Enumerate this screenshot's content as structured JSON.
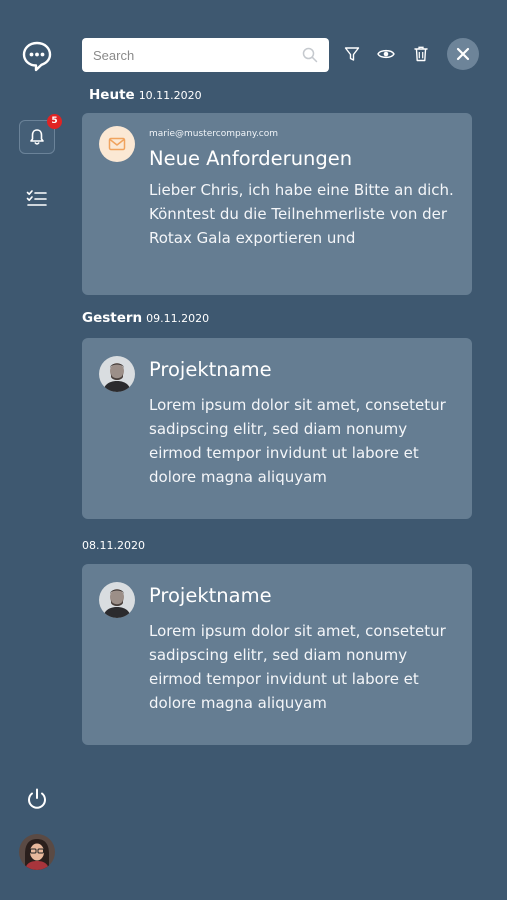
{
  "sidebar": {
    "chat_icon": "chat-bubble-icon",
    "notifications_icon": "bell-icon",
    "notifications_count": "5",
    "tasks_icon": "checklist-icon",
    "power_icon": "power-icon"
  },
  "toolbar": {
    "search_placeholder": "Search",
    "icons": [
      "search-icon",
      "filter-icon",
      "eye-icon",
      "trash-icon",
      "close-icon"
    ]
  },
  "groups": [
    {
      "day": "Heute",
      "date": "10.11.2020",
      "notification": {
        "sender": "marie@mustercompany.com",
        "title": "Neue Anforderungen",
        "body": "Lieber Chris, ich habe eine Bitte an dich. Könntest du die Teilnehmerliste von der Rotax Gala exportieren und",
        "avatar": "mail-icon"
      }
    },
    {
      "day": "Gestern",
      "date": "09.11.2020",
      "notification": {
        "title": "Projektname",
        "body": "Lorem ipsum dolor sit amet, consetetur sadipscing elitr, sed diam nonumy eirmod tempor invidunt ut labore et dolore magna aliquyam"
      }
    },
    {
      "day": "",
      "date": "08.11.2020",
      "notification": {
        "title": "Projektname",
        "body": "Lorem ipsum dolor sit amet, consetetur sadipscing elitr, sed diam nonumy eirmod tempor invidunt ut labore et dolore magna aliquyam"
      }
    }
  ],
  "colors": {
    "background": "#3e5870",
    "card": "#657d92",
    "badge": "#e02424",
    "mail_accent": "#f0a35e"
  }
}
